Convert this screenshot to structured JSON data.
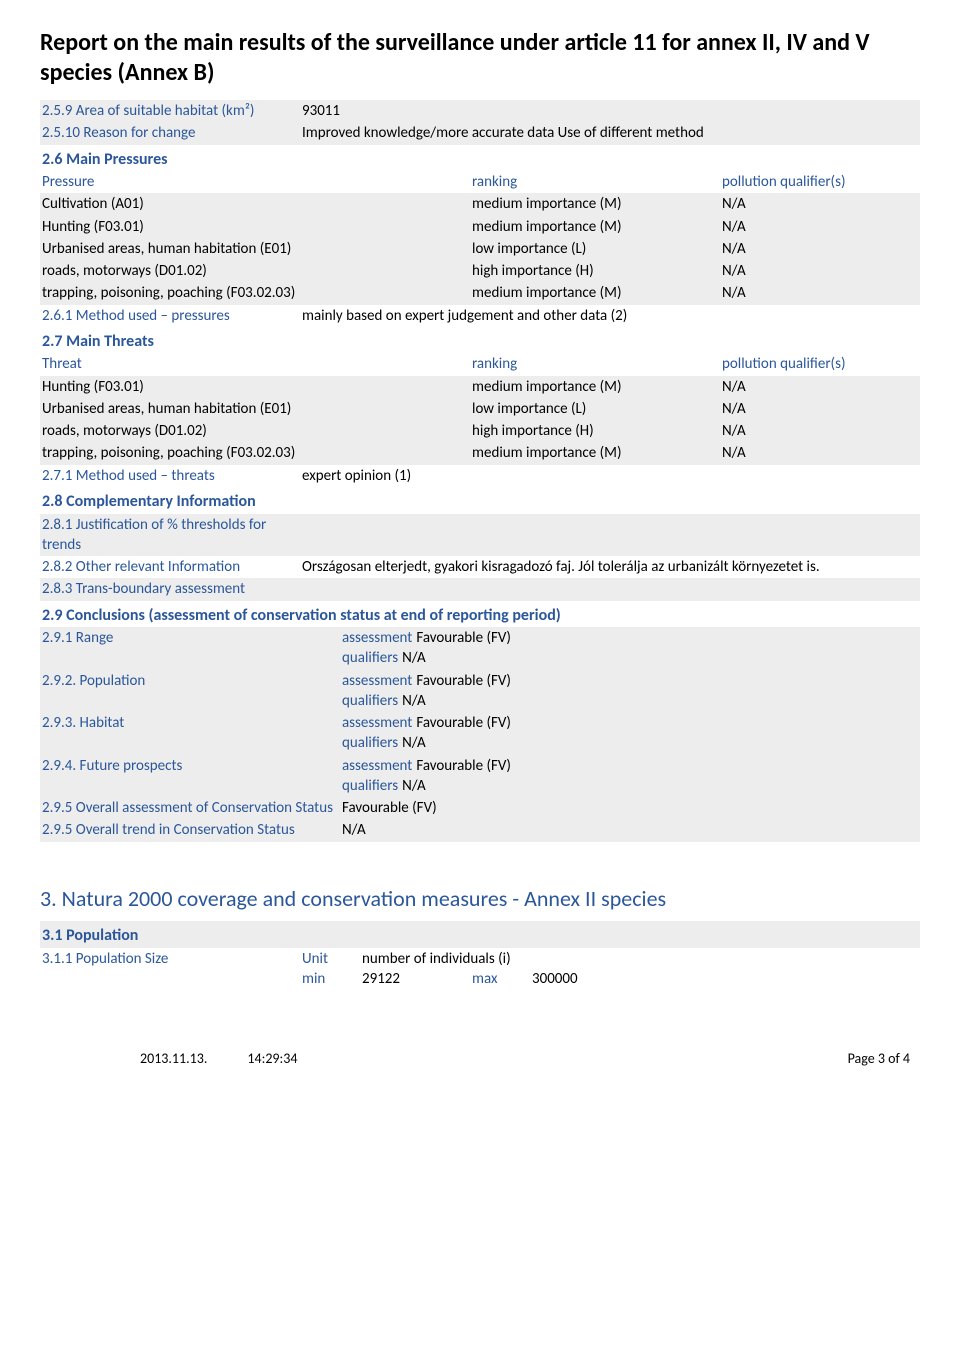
{
  "title": "Report on the main results of the surveillance under article 11 for annex II, IV and V species (Annex B)",
  "r259": {
    "label": "2.5.9 Area of suitable habitat (km²)",
    "value": "93011"
  },
  "r2510": {
    "label": "2.5.10 Reason for change",
    "value": "Improved knowledge/more accurate data Use of different method"
  },
  "s26": "2.6 Main Pressures",
  "pressHdr": {
    "c1": "Pressure",
    "c2": "ranking",
    "c3": "pollution qualifier(s)"
  },
  "press": [
    {
      "c1": "Cultivation (A01)",
      "c2": "medium importance (M)",
      "c3": "N/A"
    },
    {
      "c1": "Hunting (F03.01)",
      "c2": "medium importance (M)",
      "c3": "N/A"
    },
    {
      "c1": "Urbanised areas, human habitation (E01)",
      "c2": "low importance (L)",
      "c3": "N/A"
    },
    {
      "c1": "roads, motorways (D01.02)",
      "c2": "high importance (H)",
      "c3": "N/A"
    },
    {
      "c1": "trapping, poisoning, poaching (F03.02.03)",
      "c2": "medium importance (M)",
      "c3": "N/A"
    }
  ],
  "r261": {
    "label": "2.6.1 Method used – pressures",
    "value": "mainly based on expert judgement and other data (2)"
  },
  "s27": "2.7 Main Threats",
  "threatHdr": {
    "c1": "Threat",
    "c2": "ranking",
    "c3": "pollution qualifier(s)"
  },
  "threats": [
    {
      "c1": "Hunting (F03.01)",
      "c2": "medium importance (M)",
      "c3": "N/A"
    },
    {
      "c1": "Urbanised areas, human habitation (E01)",
      "c2": "low importance (L)",
      "c3": "N/A"
    },
    {
      "c1": "roads, motorways (D01.02)",
      "c2": "high importance (H)",
      "c3": "N/A"
    },
    {
      "c1": "trapping, poisoning, poaching (F03.02.03)",
      "c2": "medium importance (M)",
      "c3": "N/A"
    }
  ],
  "r271": {
    "label": "2.7.1 Method used – threats",
    "value": "expert opinion (1)"
  },
  "s28": "2.8 Complementary Information",
  "r281": {
    "label": "2.8.1 Justification of % thresholds for trends",
    "value": ""
  },
  "r282": {
    "label": "2.8.2 Other relevant Information",
    "value": "Országosan elterjedt, gyakori kisragadozó faj. Jól tolerálja az urbanizált környezetet is."
  },
  "r283": {
    "label": "2.8.3 Trans-boundary assessment",
    "value": ""
  },
  "s29": "2.9 Conclusions (assessment of conservation status at end of reporting period)",
  "assessLbl": "assessment",
  "qualLbl": "qualifiers",
  "r291": {
    "label": "2.9.1 Range",
    "a": "Favourable (FV)",
    "q": "N/A"
  },
  "r292": {
    "label": "2.9.2. Population",
    "a": "Favourable (FV)",
    "q": "N/A"
  },
  "r293": {
    "label": "2.9.3. Habitat",
    "a": "Favourable (FV)",
    "q": "N/A"
  },
  "r294": {
    "label": "2.9.4. Future prospects",
    "a": "Favourable (FV)",
    "q": "N/A"
  },
  "r295a": {
    "label": "2.9.5 Overall assessment of Conservation Status",
    "value": "Favourable (FV)"
  },
  "r295b": {
    "label": "2.9.5 Overall trend in Conservation Status",
    "value": "N/A"
  },
  "s3": "3. Natura 2000 coverage and conservation measures - Annex II species",
  "s31": "3.1 Population",
  "r311": {
    "label": "3.1.1 Population Size",
    "unitLbl": "Unit",
    "unitVal": "number of individuals (i)",
    "minLbl": "min",
    "minVal": "29122",
    "maxLbl": "max",
    "maxVal": "300000"
  },
  "footer": {
    "date": "2013.11.13.",
    "time": "14:29:34",
    "page": "Page 3 of 4"
  }
}
